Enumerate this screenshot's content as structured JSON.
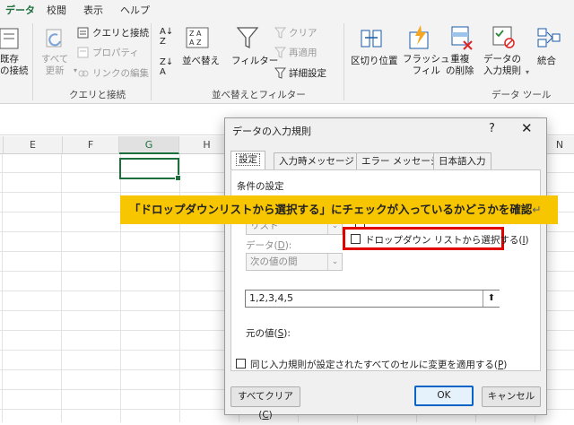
{
  "ribbon": {
    "tabs": [
      "データ",
      "校閲",
      "表示",
      "ヘルプ"
    ],
    "active_tab": "データ",
    "buttons": {
      "existing_conn_1": "既存",
      "existing_conn_2": "の接続",
      "refresh_all_1": "すべて",
      "refresh_all_2": "更新",
      "queries_conn": "クエリと接続",
      "properties": "プロパティ",
      "edit_links": "リンクの編集",
      "sort": "並べ替え",
      "filter": "フィルター",
      "clear": "クリア",
      "reapply": "再適用",
      "advanced": "詳細設定",
      "text_to_columns": "区切り位置",
      "flash_fill_1": "フラッシュ",
      "flash_fill_2": "フィル",
      "remove_dup_1": "重複",
      "remove_dup_2": "の削除",
      "data_validation_1": "データの",
      "data_validation_2": "入力規則",
      "consolidate": "統合"
    },
    "groups": {
      "queries": "クエリと接続",
      "sort_filter": "並べ替えとフィルター",
      "data_tools": "データ ツール"
    }
  },
  "sheet": {
    "columns": [
      "E",
      "F",
      "G",
      "H",
      "N"
    ],
    "selected_column": "G"
  },
  "dialog": {
    "title": "データの入力規則",
    "help": "?",
    "close": "✕",
    "tabs": [
      "設定",
      "入力時メッセージ",
      "エラー メッセージ",
      "日本語入力"
    ],
    "active_tab": "設定",
    "section_label": "条件の設定",
    "allow_value": "リスト",
    "data_label": "データ(",
    "data_label_key": "D",
    "data_label_end": "):",
    "data_value": "次の値の間",
    "dropdown_checkbox": "ドロップダウン リストから選択する(",
    "dropdown_key": "I",
    "dropdown_end": ")",
    "source_label": "元の値(",
    "source_key": "S",
    "source_end": "):",
    "source_value": "1,2,3,4,5",
    "apply_all": "同じ入力規則が設定されたすべてのセルに変更を適用する(",
    "apply_all_key": "P",
    "apply_all_end": ")",
    "clear_all": "すべてクリア(",
    "clear_all_key": "C",
    "clear_all_end": ")",
    "ok": "OK",
    "cancel": "キャンセル"
  },
  "annotation": {
    "text": "「ドロップダウンリストから選択する」にチェックが入っているかどうかを確認",
    "return_mark": "↵",
    "highlight_color": "#e00000",
    "banner_color": "#f7c600"
  }
}
